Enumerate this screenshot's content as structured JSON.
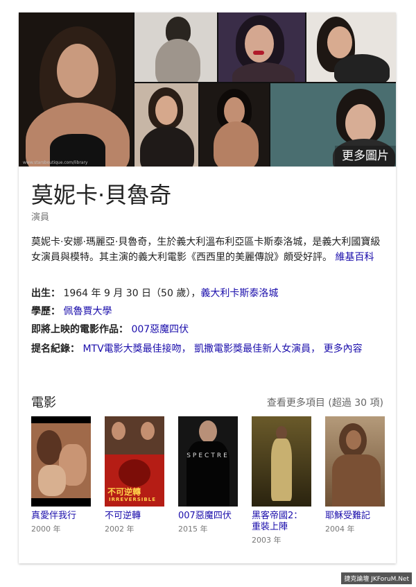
{
  "knowledge_panel": {
    "more_images_label": "更多圖片",
    "photo_credit": "www.starsboutique.com/library",
    "name": "莫妮卡·貝魯奇",
    "subtitle": "演員",
    "description": "莫妮卡·安娜·瑪麗亞·貝魯奇，生於義大利溫布利亞區卡斯泰洛城，是義大利國寶級女演員與模特。其主演的義大利電影《西西里的美麗傳說》頗受好評。",
    "description_source": "維基百科",
    "facts": {
      "born_label": "出生：",
      "born_value": "1964 年 9 月 30 日（50 歲），",
      "born_place": "義大利卡斯泰洛城",
      "education_label": "學歷：",
      "education_value": "佩魯賈大學",
      "upcoming_label": "即將上映的電影作品：",
      "upcoming_value": "007惡魔四伏",
      "nominations_label": "提名紀錄：",
      "nomination_1": "MTV電影大獎最佳接吻，",
      "nomination_2": "凱撒電影獎最佳新人女演員，",
      "nomination_more": "更多內容"
    },
    "films_section": {
      "title": "電影",
      "see_more": "查看更多項目 (超過 30 項)",
      "films": [
        {
          "title": "真愛伴我行",
          "year": "2000 年"
        },
        {
          "title": "不可逆轉",
          "year": "2002 年"
        },
        {
          "title": "007惡魔四伏",
          "year": "2015 年"
        },
        {
          "title": "黑客帝國2：重裝上陣",
          "year": "2003 年"
        },
        {
          "title": "耶穌受難記",
          "year": "2004 年"
        }
      ],
      "poster_texts": {
        "irreversible_cn": "不可逆轉",
        "irreversible_en": "IRREVERSIBLE",
        "spectre": "SPECTRE"
      }
    }
  },
  "footer": {
    "watermark": "捷克論壇 JKForuM.Net"
  },
  "colors": {
    "link": "#1a0dab",
    "text": "#222222",
    "muted": "#777777"
  }
}
